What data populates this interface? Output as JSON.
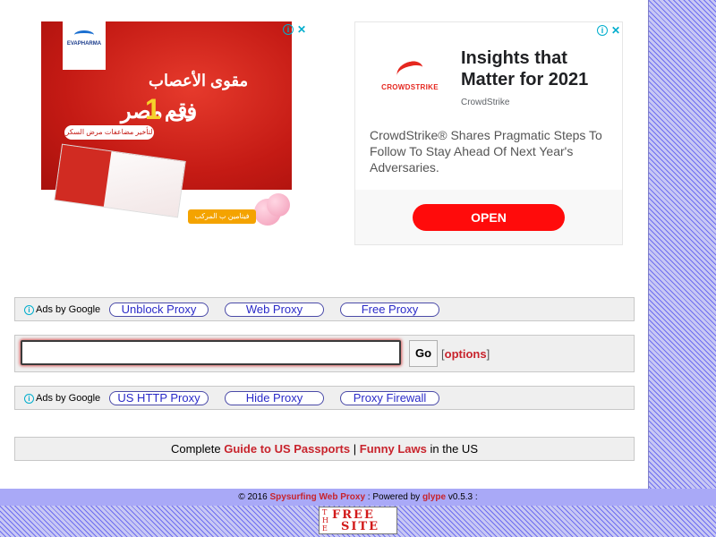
{
  "ad_left": {
    "brand": "EVAPHARMA",
    "brand_tagline": "Caring for your health",
    "headline_1": "مقوى الأعصاب",
    "headline_2_pre": "رقم",
    "headline_2_number": "1",
    "headline_2_post": "فى مصر",
    "subline": "لتأخير مضاعفات مرض السكر",
    "product": "ميلجا",
    "footer_tag": "فيتامين ب المركب",
    "adchoices_icon": "info-icon",
    "close_icon": "close-icon"
  },
  "ad_right": {
    "headline": "Insights that Matter for 2021",
    "advertiser": "CrowdStrike",
    "logo_text": "CROWDSTRIKE",
    "body": "CrowdStrike® Shares Pragmatic Steps To Follow To Stay Ahead Of Next Year's Adversaries.",
    "cta": "OPEN",
    "cta_color": "#ff0b0b"
  },
  "links_row_1": {
    "ads_by": "Ads by Google",
    "links": [
      "Unblock Proxy",
      "Web Proxy",
      "Free Proxy"
    ]
  },
  "proxy_form": {
    "url_value": "",
    "go_label": "Go",
    "options_open": "[",
    "options_label": "options",
    "options_close": "]"
  },
  "links_row_2": {
    "ads_by": "Ads by Google",
    "links": [
      "US HTTP Proxy",
      "Hide Proxy",
      "Proxy Firewall"
    ]
  },
  "footer_links": {
    "prefix": "Complete",
    "link1": "Guide to US Passports",
    "separator": "|",
    "link2": "Funny Laws",
    "suffix": "in the US"
  },
  "credit": {
    "copyright": "© 2016",
    "site_name": "Spysurfing Web Proxy",
    "powered": ": Powered by",
    "engine": "glype",
    "version": "v0.5.3 :"
  },
  "badge": {
    "the": "THE",
    "free": "FREE",
    "site": "SITE"
  },
  "colors": {
    "accent_red": "#c8232c",
    "link_blue": "#2a2ac8",
    "footer_bar": "#a9a9f7"
  }
}
